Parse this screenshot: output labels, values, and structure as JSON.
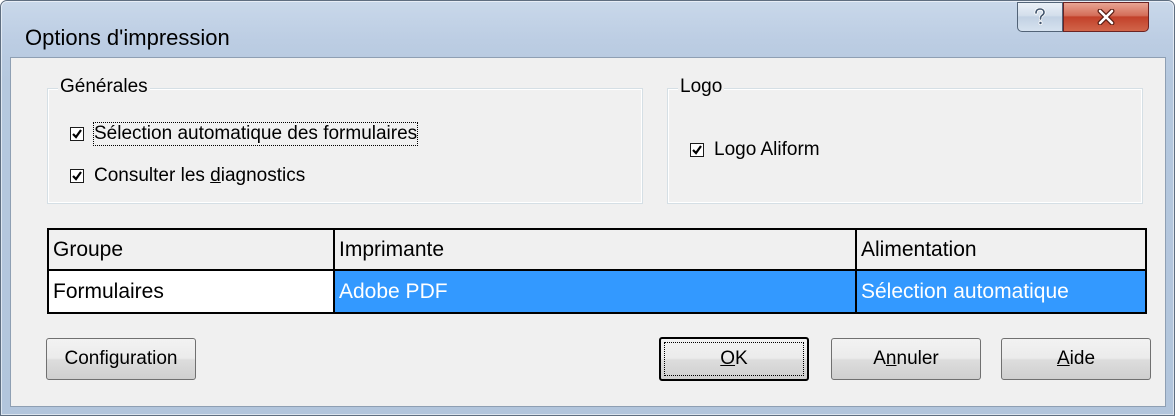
{
  "window": {
    "title": "Options d'impression",
    "help_icon": "question-mark-icon",
    "close_icon": "close-x-icon",
    "colors": {
      "frame": "#b9cbe0",
      "client": "#f0f0f0",
      "close": "#c7432b",
      "selection": "#3399ff"
    }
  },
  "general_group": {
    "legend": "Générales",
    "options": [
      {
        "label": "Sélection automatique des formulaires",
        "checked": true,
        "focused": true
      },
      {
        "label_pre": "Consulter les ",
        "label_accel": "d",
        "label_post": "iagnostics",
        "checked": true
      }
    ]
  },
  "logo_group": {
    "legend": "Logo",
    "options": [
      {
        "label": "Logo Aliform",
        "checked": true
      }
    ]
  },
  "grid": {
    "columns": [
      "Groupe",
      "Imprimante",
      "Alimentation"
    ],
    "rows": [
      {
        "groupe": "Formulaires",
        "imprimante": "Adobe PDF",
        "alimentation": "Sélection automatique",
        "selected": true
      }
    ]
  },
  "buttons": {
    "configuration": "Configuration",
    "ok_accel": "O",
    "ok_rest": "K",
    "annuler_pre": "A",
    "annuler_accel": "n",
    "annuler_rest": "nuler",
    "aide_accel": "A",
    "aide_rest": "ide"
  }
}
